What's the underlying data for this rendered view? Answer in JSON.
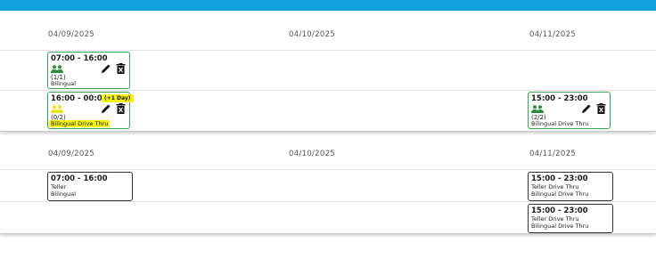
{
  "colors": {
    "topbar": "#0fa0dd",
    "card_border": "#3aa655",
    "highlight": "#f7f20a",
    "people_filled": "#2e8b3a",
    "people_partial": "#f2e600"
  },
  "schedule": {
    "dates": [
      "04/09/2025",
      "04/10/2025",
      "04/11/2025"
    ],
    "shifts": [
      {
        "time": "07:00 - 16:00",
        "count": "(1/1)",
        "role": "Bilingual",
        "badge": "",
        "people_icon": "people-icon"
      },
      {
        "time": "16:00 - 00:00",
        "count": "(0/2)",
        "role": "Bilingual Drive Thru",
        "badge": "(+1 Day)",
        "people_icon": "people-icon"
      },
      {
        "time": "15:00 - 23:00",
        "count": "(2/2)",
        "role": "Bilingual Drive Thru",
        "badge": "",
        "people_icon": "people-icon"
      }
    ]
  },
  "assignments": {
    "dates": [
      "04/09/2025",
      "04/10/2025",
      "04/11/2025"
    ],
    "items": [
      {
        "time": "07:00 - 16:00",
        "line1": "Teller",
        "line2": "Bilingual"
      },
      {
        "time": "15:00 - 23:00",
        "line1": "Teller Drive Thru",
        "line2": "Bilingual Drive Thru"
      },
      {
        "time": "15:00 - 23:00",
        "line1": "Teller Drive Thru",
        "line2": "Bilingual Drive Thru"
      }
    ]
  }
}
